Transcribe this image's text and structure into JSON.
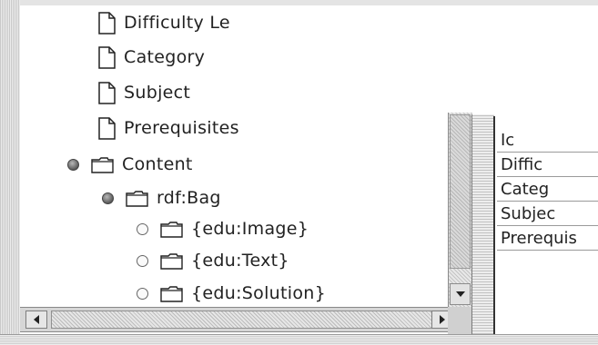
{
  "tree": {
    "nodes": [
      {
        "label": "Difficulty Le",
        "icon": "document-icon"
      },
      {
        "label": "Category",
        "icon": "document-icon"
      },
      {
        "label": "Subject",
        "icon": "document-icon"
      },
      {
        "label": "Prerequisites",
        "icon": "document-icon"
      },
      {
        "label": "Content",
        "icon": "folder-icon"
      },
      {
        "label": "rdf:Bag",
        "icon": "folder-icon"
      },
      {
        "label": "{edu:Image}",
        "icon": "folder-icon"
      },
      {
        "label": "{edu:Text}",
        "icon": "folder-icon"
      },
      {
        "label": "{edu:Solution}",
        "icon": "folder-icon"
      }
    ]
  },
  "right_panel": {
    "cells": [
      "Ic",
      "Diffic",
      "Categ",
      "Subjec",
      "Prerequis"
    ]
  },
  "colors": {
    "frame": "#e4e4e4",
    "scrollbar": "#d6d6d6",
    "text": "#222222"
  }
}
